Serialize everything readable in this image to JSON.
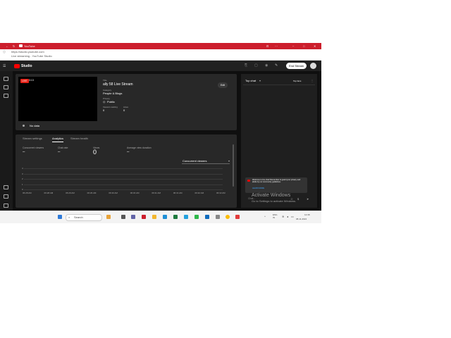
{
  "browser": {
    "tab_title": "YouTube",
    "url": "https://studio.youtube.com",
    "page_title": "Live streaming - YouTube Studio"
  },
  "studio": {
    "logo": "Studio",
    "end_stream_label": "End Stream"
  },
  "stream": {
    "live_badge": "LIVE",
    "timer": "0:13",
    "title_label": "Title",
    "title": "ally 58 Live Stream",
    "category_label": "Category",
    "category": "People & Blogs",
    "privacy_label": "Privacy",
    "privacy": "Public",
    "viewers_label": "Viewers waiting",
    "viewers": "0",
    "likes_label": "Likes",
    "likes": "0",
    "edit_label": "Edit",
    "no_data": "No data"
  },
  "tabs": [
    "Stream settings",
    "Analytics",
    "Stream health"
  ],
  "stats": [
    {
      "label": "Concurrent viewers",
      "value": "–"
    },
    {
      "label": "Chat rate",
      "value": "–"
    },
    {
      "label": "Views",
      "value": "0"
    },
    {
      "label": "Average view duration",
      "value": "–"
    }
  ],
  "chart_select": "Concurrent viewers",
  "chart_data": {
    "type": "line",
    "y_ticks": [
      "4",
      "3",
      "2",
      "1",
      "0"
    ],
    "x_ticks": [
      "06:28 AM",
      "06:28 AM",
      "06:29 AM",
      "06:29 AM",
      "06:30 AM",
      "06:30 AM",
      "06:31 AM",
      "06:31 AM",
      "06:32 AM",
      "06:32 AM"
    ],
    "ylim": [
      0,
      4
    ],
    "grid": true
  },
  "chat": {
    "header": "Top chat",
    "top_fans": "Top fans",
    "welcome": "Welcome to live chat! Remember to guard your privacy and abide by our community guidelines.",
    "learn_more": "LEARN MORE",
    "input_placeholder": "Chat..."
  },
  "watermark": {
    "line1": "Activate Windows",
    "line2": "Go to Settings to activate Windows."
  },
  "taskbar": {
    "search": "Search",
    "lang": "ENG\nIN",
    "time": "12:38",
    "date": "08-11-2024"
  },
  "colors": {
    "accent": "#cc1e2c",
    "live": "#e62117"
  },
  "icons": {
    "taskbar": [
      "windows-icon",
      "search-icon",
      "widget-icon",
      "chat-icon",
      "files-icon",
      "edge-icon",
      "store-icon",
      "chrome-icon",
      "youtube-icon",
      "mail-icon"
    ]
  }
}
